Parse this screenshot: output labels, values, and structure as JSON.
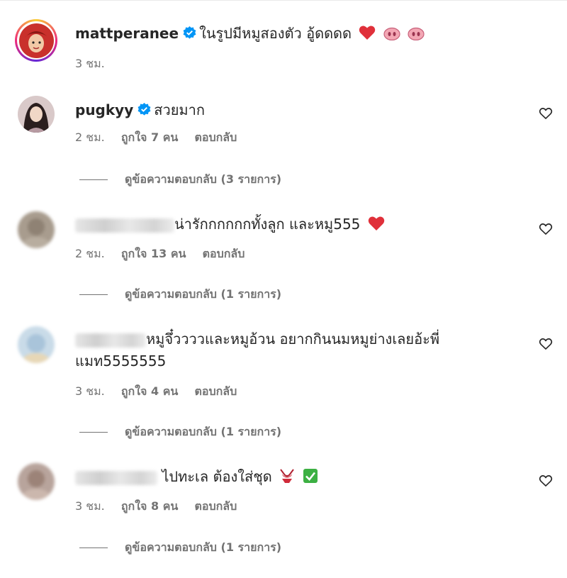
{
  "colors": {
    "text": "#262626",
    "secondary": "#737373",
    "verified": "#0095f6",
    "heart_emoji": "#e0303a"
  },
  "comments": [
    {
      "username": "mattperanee",
      "verified": true,
      "text": "ในรูปมีหมูสองตัว อู้ดดดด",
      "emojis": [
        "red-heart",
        "pig-nose",
        "pig-nose"
      ],
      "time": "3 ชม.",
      "likes": "",
      "reply": ""
    },
    {
      "username": "pugkyy",
      "verified": true,
      "text": "สวยมาก",
      "time": "2 ชม.",
      "likes": "ถูกใจ 7 คน",
      "reply": "ตอบกลับ",
      "view_replies": "ดูข้อความตอบกลับ (3 รายการ)"
    },
    {
      "username": "",
      "verified": false,
      "text": "น่ารักกกกกกทั้งลูก และหมู555",
      "emojis": [
        "red-heart"
      ],
      "time": "2 ชม.",
      "likes": "ถูกใจ 13 คน",
      "reply": "ตอบกลับ",
      "view_replies": "ดูข้อความตอบกลับ (1 รายการ)"
    },
    {
      "username": "",
      "verified": false,
      "text": "หมูจึ๋ววววและหมูอ้วน อยากกินนมหมูย่างเลยอ้ะพี่",
      "text2": "แมท5555555",
      "time": "3 ชม.",
      "likes": "ถูกใจ 4 คน",
      "reply": "ตอบกลับ",
      "view_replies": "ดูข้อความตอบกลับ (1 รายการ)"
    },
    {
      "username": "",
      "verified": false,
      "text": "ไปทะเล ต้องใส่ชุด",
      "emojis": [
        "bikini",
        "check-mark"
      ],
      "time": "3 ชม.",
      "likes": "ถูกใจ 8 คน",
      "reply": "ตอบกลับ",
      "view_replies": "ดูข้อความตอบกลับ (1 รายการ)"
    }
  ]
}
